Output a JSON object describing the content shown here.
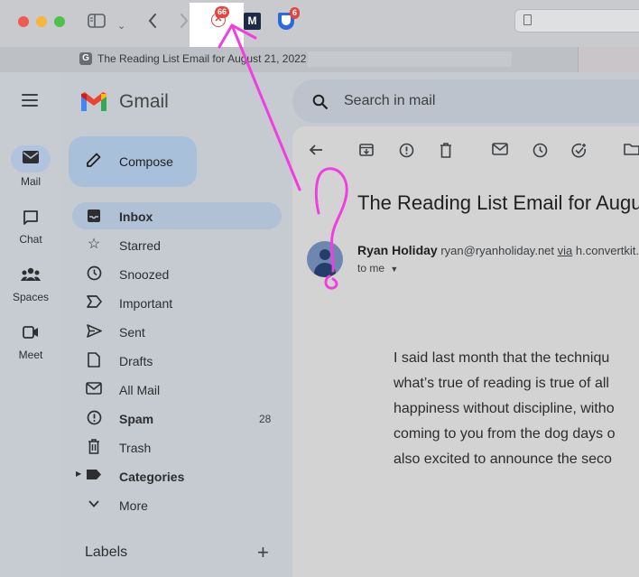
{
  "browser": {
    "tab_favicon_letter": "G",
    "tab_title": "The Reading List Email for August 21, 2022 -",
    "extensions": [
      {
        "name": "x-extension",
        "badge": "66"
      },
      {
        "name": "m-extension",
        "letter": "M"
      },
      {
        "name": "bitwarden-extension",
        "badge": "6"
      }
    ]
  },
  "gmail": {
    "logo_text": "Gmail",
    "search_placeholder": "Search in mail",
    "rail": [
      {
        "label": "Mail",
        "icon": "mail-icon",
        "active": true
      },
      {
        "label": "Chat",
        "icon": "chat-icon"
      },
      {
        "label": "Spaces",
        "icon": "spaces-icon"
      },
      {
        "label": "Meet",
        "icon": "meet-icon"
      }
    ],
    "compose_label": "Compose",
    "nav": [
      {
        "label": "Inbox",
        "icon": "inbox-icon",
        "active": true,
        "bold": true
      },
      {
        "label": "Starred",
        "icon": "star-icon"
      },
      {
        "label": "Snoozed",
        "icon": "clock-icon"
      },
      {
        "label": "Important",
        "icon": "important-icon"
      },
      {
        "label": "Sent",
        "icon": "send-icon"
      },
      {
        "label": "Drafts",
        "icon": "draft-icon"
      },
      {
        "label": "All Mail",
        "icon": "all-mail-icon"
      },
      {
        "label": "Spam",
        "icon": "spam-icon",
        "bold": true,
        "count": "28"
      },
      {
        "label": "Trash",
        "icon": "trash-icon"
      },
      {
        "label": "Categories",
        "icon": "label-icon",
        "bold": true
      },
      {
        "label": "More",
        "icon": "chevron-down-icon"
      }
    ],
    "labels_title": "Labels",
    "email": {
      "subject": "The Reading List Email for Augus",
      "sender_name": "Ryan Holiday",
      "sender_email": "ryan@ryanholiday.net",
      "via_label": "via",
      "via_domain": "h.convertkit.co",
      "to_label": "to me",
      "body_lines": [
        "I said last month that the techniqu",
        "what’s true of reading is true of all",
        "happiness without discipline, witho",
        "coming to you from the dog days o",
        "also excited to announce the seco"
      ]
    }
  },
  "annotation": {
    "color": "#f23ee0"
  }
}
